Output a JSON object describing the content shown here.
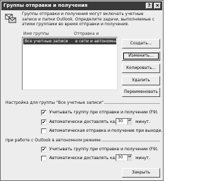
{
  "window": {
    "title": "Группы отправки и получения",
    "help_glyph": "?",
    "close_glyph": "×"
  },
  "intro": {
    "icon": "send-receive-icon",
    "text": "Группы отправки и получения могут включать учетные записи и папки Outlook. Определите задачи, выполняемые с этими группами во время отправки и получения."
  },
  "list": {
    "headers": [
      "Имя группы",
      "Отправка и получение"
    ],
    "rows": [
      {
        "name": "Все учетные записи",
        "status": "в сети и автономна"
      }
    ]
  },
  "buttons": {
    "create": "Создать...",
    "edit": "Изменить...",
    "copy": "Копировать...",
    "delete": "Удалить",
    "rename": "Переименовать",
    "close": "Закрыть"
  },
  "group_online": {
    "label": "Настройка для группы \"Все учетные записи\"",
    "opt1": {
      "checked": true,
      "label": "Учитывать группу при отправке и получении (F9)."
    },
    "opt2": {
      "checked": true,
      "label": "Автоматически доставлять каждые",
      "value": "30",
      "unit": "минут."
    },
    "opt3": {
      "checked": false,
      "label": "Автоматическая отправка и получение при выходе."
    }
  },
  "group_offline": {
    "label": "при работе с Outlook в автономном режиме",
    "opt1": {
      "checked": true,
      "label": "Учитывать группу при отправке и получении (F9)."
    },
    "opt2": {
      "checked": false,
      "label": "Автоматически доставлять каждые",
      "value": "30",
      "unit": "минут."
    }
  },
  "checkmark": "✔",
  "spin_glyph": "▴▾"
}
